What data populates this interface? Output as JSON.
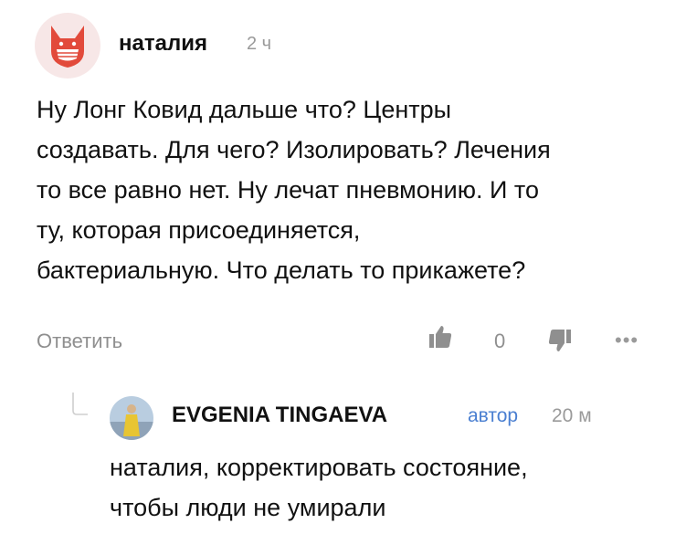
{
  "comment": {
    "author": "наталия",
    "time": "2 ч",
    "text": "Ну Лонг Ковид дальше что? Центры\nсоздавать. Для чего? Изолировать? Лечения\nто все равно нет. Ну лечат пневмонию. И то\nту, которая присоединяется,\nбактериальную. Что делать то прикажете?",
    "reply_label": "Ответить",
    "like_count": "0",
    "avatar_icon": "fox-mask-icon",
    "colors": {
      "avatar_bg": "#f7e7e7",
      "avatar_fox": "#e24a3b"
    }
  },
  "reply": {
    "author": "EVGENIA TINGAEVA",
    "badge": "автор",
    "time": "20 м",
    "text": "наталия, корректировать состояние,\nчтобы люди не умирали",
    "colors": {
      "badge": "#4a7fd1"
    }
  }
}
